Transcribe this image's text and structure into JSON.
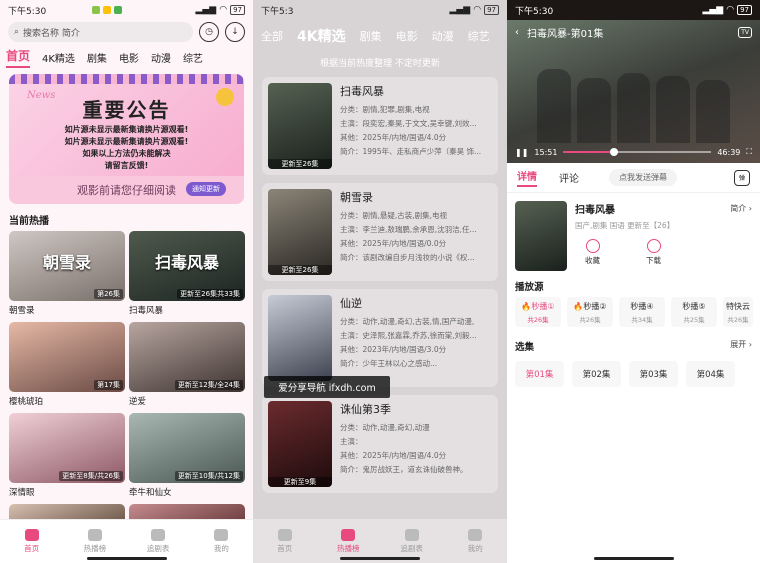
{
  "status": {
    "time": "下午5:30",
    "battery": "97",
    "time_short": "下午5:3"
  },
  "home": {
    "search_placeholder": "搜索名称 简介",
    "categories": [
      "首页",
      "4K精选",
      "剧集",
      "电影",
      "动漫",
      "综艺"
    ],
    "banner": {
      "tag": "News",
      "title": "重要公告",
      "lines": [
        "如片源未显示最新集请换片源观看!",
        "如片源未显示最新集请换片源观看!",
        "如果以上方法仍未能解决",
        "请留言反馈!"
      ],
      "footer": "观影前请您仔细阅读",
      "pill": "通知更新"
    },
    "section_title": "当前热播",
    "cards": [
      {
        "title": "朝雪录",
        "badge": "第26集",
        "thumb_text": "朝雪录"
      },
      {
        "title": "扫毒风暴",
        "badge": "更新至26集共33集",
        "thumb_text": "扫毒风暴"
      },
      {
        "title": "樱桃琥珀",
        "badge": "第17集",
        "thumb_text": ""
      },
      {
        "title": "逆爱",
        "badge": "更新至12集/全24集",
        "thumb_text": ""
      },
      {
        "title": "深情眼",
        "badge": "更新至8集/共26集",
        "thumb_text": ""
      },
      {
        "title": "牵牛和仙女",
        "badge": "更新至10集/共12集",
        "thumb_text": ""
      }
    ]
  },
  "tabbar": [
    {
      "label": "首页",
      "icon": "home-icon"
    },
    {
      "label": "热播榜",
      "icon": "crown-icon"
    },
    {
      "label": "追剧表",
      "icon": "calendar-icon"
    },
    {
      "label": "我的",
      "icon": "user-icon"
    }
  ],
  "rank": {
    "categories": [
      "全部",
      "4K精选",
      "剧集",
      "电影",
      "动漫",
      "综艺"
    ],
    "subtitle": "根据当前热度整理 不定时更新",
    "items": [
      {
        "title": "扫毒风暴",
        "badge": "更新至26集",
        "type": "分类：剧情,犯罪,剧集,电视",
        "cast": "主演：段奕宏,秦昊,于文文,吴幸键,刘效...",
        "other": "其他：2025年/内地/国语/4.0分",
        "intro": "简介：1995年、走私商卢少萍（秦昊 饰..."
      },
      {
        "title": "朝雪录",
        "badge": "更新至26集",
        "type": "分类：剧情,悬疑,古装,剧集,电视",
        "cast": "主演：李兰迪,敖瑞鹏,余承恩,沈羽洁,任...",
        "other": "其他：2025年/内地/国语/0.0分",
        "intro": "简介：该剧改编自步月浅妆的小说《权..."
      },
      {
        "title": "仙逆",
        "badge": "",
        "type": "分类：动作,动漫,奇幻,古装,情,国产动漫,",
        "cast": "主演：史泽熙,张嘉霖,乔苏,徐而棠,刘毅...",
        "other": "其他：2023年/内地/国语/3.0分",
        "intro": "简介：少年王林以心之感动..."
      },
      {
        "title": "诛仙第3季",
        "badge": "更新至9集",
        "type": "分类：动作,动漫,奇幻,动漫",
        "cast": "主演：",
        "other": "其他：2025年/内地/国语/4.0分",
        "intro": "简介：鬼厉战妖王，道玄诛仙破兽神。"
      }
    ]
  },
  "detail": {
    "player_title": "扫毒风暴-第01集",
    "tv_label": "TV",
    "time_current": "15:51",
    "time_total": "46:39",
    "progress": 0.34,
    "tabs": [
      "详情",
      "评论"
    ],
    "danmu_placeholder": "点我发送弹幕",
    "danmu_button": "弹",
    "title": "扫毒风暴",
    "intro_label": "简介 ›",
    "tags": "国产,剧集 国语 更新至【26】",
    "actions": [
      {
        "label": "收藏",
        "icon": "heart-icon"
      },
      {
        "label": "下载",
        "icon": "download-icon"
      }
    ],
    "sources_title": "播放源",
    "sources": [
      {
        "label": "🔥秒播①",
        "count": "共26集"
      },
      {
        "label": "🔥秒播②",
        "count": "共26集"
      },
      {
        "label": "秒播④",
        "count": "共34集"
      },
      {
        "label": "秒播⑤",
        "count": "共25集"
      },
      {
        "label": "特快云",
        "count": "共26集"
      }
    ],
    "episodes_title": "选集",
    "expand_label": "展开 ›",
    "episodes": [
      "第01集",
      "第02集",
      "第03集",
      "第04集"
    ]
  },
  "watermark": "爱分享导航 ifxdh.com"
}
